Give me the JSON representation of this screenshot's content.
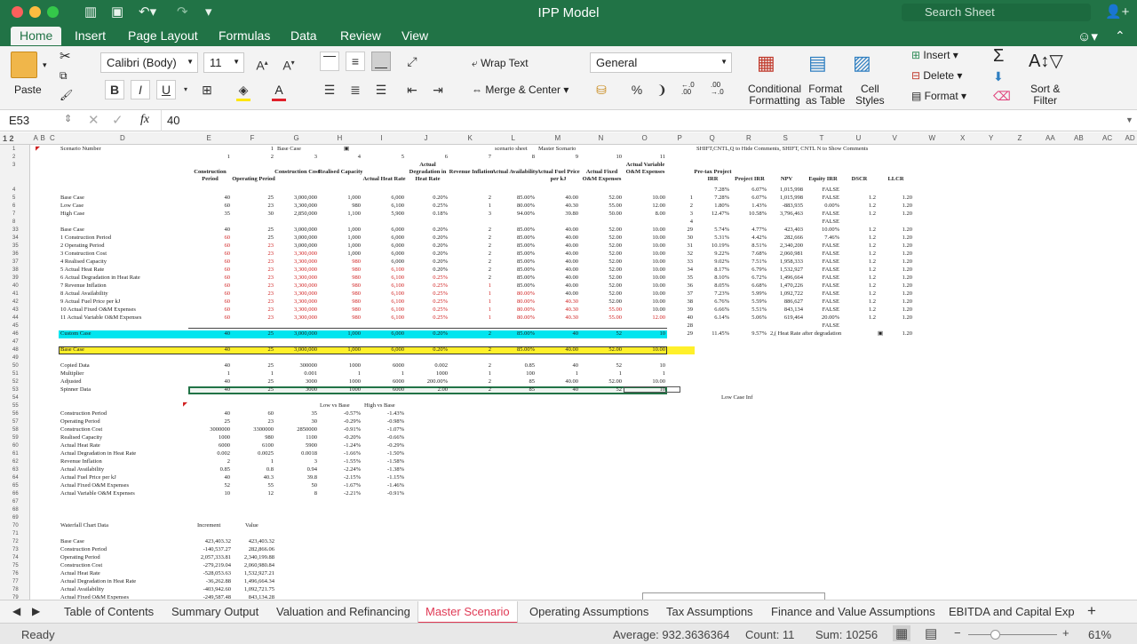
{
  "window": {
    "title": "IPP Model",
    "search_placeholder": "Search Sheet"
  },
  "ribbon_tabs": [
    "Home",
    "Insert",
    "Page Layout",
    "Formulas",
    "Data",
    "Review",
    "View"
  ],
  "ribbon": {
    "paste": "Paste",
    "font_name": "Calibri (Body)",
    "font_size": "11",
    "bold": "B",
    "italic": "I",
    "underline": "U",
    "wrap_text": "Wrap Text",
    "merge_center": "Merge & Center",
    "number_format": "General",
    "percent": "%",
    "comma": "❩",
    "conditional_formatting": [
      "Conditional",
      "Formatting"
    ],
    "format_as_table": [
      "Format",
      "as Table"
    ],
    "cell_styles": [
      "Cell",
      "Styles"
    ],
    "insert": "Insert",
    "delete": "Delete",
    "format": "Format",
    "sort_filter": [
      "Sort &",
      "Filter"
    ]
  },
  "formula_bar": {
    "name_box": "E53",
    "fx": "fx",
    "value": "40"
  },
  "columns": [
    "A",
    "B",
    "C",
    "D",
    "E",
    "F",
    "G",
    "H",
    "I",
    "J",
    "K",
    "L",
    "M",
    "N",
    "O",
    "P",
    "Q",
    "R",
    "S",
    "T",
    "U",
    "V",
    "W",
    "X",
    "Y",
    "Z",
    "AA",
    "AB",
    "AC",
    "AD"
  ],
  "outline_levels": "1 2",
  "top": {
    "scenario_number": "Scenario Number",
    "scenario_index": "1",
    "base_case_label": "Base Case",
    "scenario_sheet": "scenario sheet",
    "master_scenario": "Master Scenario",
    "shortcut_note": "SHIFT,CNTL,Q to Hide Comments, SHIFT, CNTL N to Show Comments",
    "col_numbers": [
      "1",
      "2",
      "3",
      "4",
      "5",
      "6",
      "7",
      "8",
      "9",
      "10",
      "11"
    ]
  },
  "headers": [
    "Construction Period",
    "Operating Period",
    "Construction Cost",
    "Realised Capacity",
    "Actual Heat Rate",
    "Actual Degradation in Heat Rate",
    "Revenue Inflation",
    "Actual Availability",
    "Actual Fuel Price per kJ",
    "Actual Fixed O&M Expenses",
    "Actual Variable O&M Expenses"
  ],
  "result_headers": [
    "Pre-tax Project IRR",
    "Project IRR",
    "NPV",
    "Equity IRR",
    "DSCR",
    "LLCR"
  ],
  "rows_top": [
    {
      "n": "4",
      "label": "",
      "v": [],
      "idx": "",
      "res": [
        "7.28%",
        "6.07%",
        "1,015,998",
        "FALSE",
        "",
        ""
      ]
    },
    {
      "n": "5",
      "label": "Base Case",
      "v": [
        "40",
        "25",
        "3,000,000",
        "1,000",
        "6,000",
        "0.20%",
        "2",
        "85.00%",
        "40.00",
        "52.00",
        "10.00"
      ],
      "idx": "1",
      "res": [
        "7.28%",
        "6.07%",
        "1,015,998",
        "FALSE",
        "1.2",
        "1.20"
      ]
    },
    {
      "n": "6",
      "label": "Low Case",
      "v": [
        "60",
        "23",
        "3,300,000",
        "980",
        "6,100",
        "0.25%",
        "1",
        "80.00%",
        "40.30",
        "55.00",
        "12.00"
      ],
      "idx": "2",
      "res": [
        "1.80%",
        "1.43%",
        "-883,935",
        "0.00%",
        "1.2",
        "1.20"
      ]
    },
    {
      "n": "7",
      "label": "High Case",
      "v": [
        "35",
        "30",
        "2,850,000",
        "1,100",
        "5,900",
        "0.18%",
        "3",
        "94.00%",
        "39.80",
        "50.00",
        "8.00"
      ],
      "idx": "3",
      "res": [
        "12.47%",
        "10.58%",
        "3,796,463",
        "FALSE",
        "1.2",
        "1.20"
      ]
    },
    {
      "n": "8",
      "label": "",
      "v": [],
      "idx": "4",
      "res": [
        "",
        "",
        "",
        "FALSE",
        "",
        ""
      ]
    }
  ],
  "rows_sens": [
    {
      "n": "33",
      "label": "Base Case",
      "red": 0,
      "v": [
        "40",
        "25",
        "3,000,000",
        "1,000",
        "6,000",
        "0.20%",
        "2",
        "85.00%",
        "40.00",
        "52.00",
        "10.00"
      ],
      "idx": "29",
      "res": [
        "5.74%",
        "4.77%",
        "423,403",
        "10.00%",
        "1.2",
        "1.20"
      ]
    },
    {
      "n": "34",
      "label": "1 Construction Period",
      "red": 1,
      "v": [
        "60",
        "25",
        "3,000,000",
        "1,000",
        "6,000",
        "0.20%",
        "2",
        "85.00%",
        "40.00",
        "52.00",
        "10.00"
      ],
      "idx": "30",
      "res": [
        "5.31%",
        "4.42%",
        "282,666",
        "7.46%",
        "1.2",
        "1.20"
      ]
    },
    {
      "n": "35",
      "label": "2 Operating Period",
      "red": 2,
      "v": [
        "60",
        "23",
        "3,000,000",
        "1,000",
        "6,000",
        "0.20%",
        "2",
        "85.00%",
        "40.00",
        "52.00",
        "10.00"
      ],
      "idx": "31",
      "res": [
        "10.19%",
        "8.51%",
        "2,340,200",
        "FALSE",
        "1.2",
        "1.20"
      ]
    },
    {
      "n": "36",
      "label": "3 Construction Cost",
      "red": 3,
      "v": [
        "60",
        "23",
        "3,300,000",
        "1,000",
        "6,000",
        "0.20%",
        "2",
        "85.00%",
        "40.00",
        "52.00",
        "10.00"
      ],
      "idx": "32",
      "res": [
        "9.22%",
        "7.68%",
        "2,060,981",
        "FALSE",
        "1.2",
        "1.20"
      ]
    },
    {
      "n": "37",
      "label": "4 Realised Capacity",
      "red": 4,
      "v": [
        "60",
        "23",
        "3,300,000",
        "980",
        "6,000",
        "0.20%",
        "2",
        "85.00%",
        "40.00",
        "52.00",
        "10.00"
      ],
      "idx": "33",
      "res": [
        "9.02%",
        "7.51%",
        "1,958,333",
        "FALSE",
        "1.2",
        "1.20"
      ]
    },
    {
      "n": "38",
      "label": "5 Actual Heat Rate",
      "red": 5,
      "v": [
        "60",
        "23",
        "3,300,000",
        "980",
        "6,100",
        "0.20%",
        "2",
        "85.00%",
        "40.00",
        "52.00",
        "10.00"
      ],
      "idx": "34",
      "res": [
        "8.17%",
        "6.79%",
        "1,532,927",
        "FALSE",
        "1.2",
        "1.20"
      ]
    },
    {
      "n": "39",
      "label": "6 Actual Degradation in Heat Rate",
      "red": 6,
      "v": [
        "60",
        "23",
        "3,300,000",
        "980",
        "6,100",
        "0.25%",
        "2",
        "85.00%",
        "40.00",
        "52.00",
        "10.00"
      ],
      "idx": "35",
      "res": [
        "8.10%",
        "6.72%",
        "1,496,664",
        "FALSE",
        "1.2",
        "1.20"
      ]
    },
    {
      "n": "40",
      "label": "7 Revenue Inflation",
      "red": 7,
      "v": [
        "60",
        "23",
        "3,300,000",
        "980",
        "6,100",
        "0.25%",
        "1",
        "85.00%",
        "40.00",
        "52.00",
        "10.00"
      ],
      "idx": "36",
      "res": [
        "8.05%",
        "6.68%",
        "1,470,226",
        "FALSE",
        "1.2",
        "1.20"
      ]
    },
    {
      "n": "41",
      "label": "8 Actual Availability",
      "red": 8,
      "v": [
        "60",
        "23",
        "3,300,000",
        "980",
        "6,100",
        "0.25%",
        "1",
        "80.00%",
        "40.00",
        "52.00",
        "10.00"
      ],
      "idx": "37",
      "res": [
        "7.23%",
        "5.99%",
        "1,092,722",
        "FALSE",
        "1.2",
        "1.20"
      ]
    },
    {
      "n": "42",
      "label": "9 Actual Fuel Price per kJ",
      "red": 9,
      "v": [
        "60",
        "23",
        "3,300,000",
        "980",
        "6,100",
        "0.25%",
        "1",
        "80.00%",
        "40.30",
        "52.00",
        "10.00"
      ],
      "idx": "38",
      "res": [
        "6.76%",
        "5.59%",
        "886,627",
        "FALSE",
        "1.2",
        "1.20"
      ]
    },
    {
      "n": "43",
      "label": "10 Actual Fixed O&M Expenses",
      "red": 10,
      "v": [
        "60",
        "23",
        "3,300,000",
        "980",
        "6,100",
        "0.25%",
        "1",
        "80.00%",
        "40.30",
        "55.00",
        "10.00"
      ],
      "idx": "39",
      "res": [
        "6.66%",
        "5.51%",
        "843,134",
        "FALSE",
        "1.2",
        "1.20"
      ]
    },
    {
      "n": "44",
      "label": "11 Actual Variable O&M Expenses",
      "red": 11,
      "v": [
        "60",
        "23",
        "3,300,000",
        "980",
        "6,100",
        "0.25%",
        "1",
        "80.00%",
        "40.30",
        "55.00",
        "12.00"
      ],
      "idx": "40",
      "res": [
        "6.14%",
        "5.06%",
        "619,464",
        "20.00%",
        "1.2",
        "1.20"
      ]
    }
  ],
  "row45": {
    "idx": "28",
    "res": "FALSE"
  },
  "custom_case": {
    "label": "Custom Case",
    "v": [
      "40",
      "25",
      "3,000,000",
      "1,000",
      "6,000",
      "0.20%",
      "2",
      "85.00%",
      "40",
      "52",
      "10"
    ],
    "idx": "29",
    "res": [
      "11.45%",
      "9.57%",
      "2,( Heat Rate after degradation"
    ],
    "llcr": "1.20"
  },
  "base_case2": {
    "label": "Base Case",
    "v": [
      "40",
      "25",
      "3,000,000",
      "1,000",
      "6,000",
      "0.20%",
      "2",
      "85.00%",
      "40.00",
      "52.00",
      "10.00"
    ]
  },
  "copied": [
    {
      "n": "50",
      "label": "Copied Data",
      "v": [
        "40",
        "25",
        "300000",
        "1000",
        "6000",
        "0.002",
        "2",
        "0.85",
        "40",
        "52",
        "10"
      ]
    },
    {
      "n": "51",
      "label": "Multiplier",
      "v": [
        "1",
        "1",
        "0.001",
        "1",
        "1",
        "1000",
        "1",
        "100",
        "1",
        "1",
        "1"
      ]
    },
    {
      "n": "52",
      "label": "Adjusted",
      "v": [
        "40",
        "25",
        "3000",
        "1000",
        "6000",
        "200.00%",
        "2",
        "85",
        "40.00",
        "52.00",
        "10.00"
      ]
    },
    {
      "n": "53",
      "label": "Spinner Data",
      "v": [
        "40",
        "25",
        "3000",
        "1000",
        "6000",
        "2.00",
        "2",
        "85",
        "40",
        "52",
        "10"
      ]
    }
  ],
  "low_case_info": "Low Case Inf",
  "sens_table": {
    "h1": "Low vs Base",
    "h2": "High vs Base",
    "rows": [
      {
        "n": "56",
        "label": "Construction Period",
        "v": [
          "40",
          "60",
          "35",
          "-0.57%",
          "-1.43%"
        ]
      },
      {
        "n": "57",
        "label": "Operating Period",
        "v": [
          "25",
          "23",
          "30",
          "-0.29%",
          "-0.98%"
        ]
      },
      {
        "n": "58",
        "label": "Construction Cost",
        "v": [
          "3000000",
          "3300000",
          "2850000",
          "-0.91%",
          "-1.07%"
        ]
      },
      {
        "n": "59",
        "label": "Realised Capacity",
        "v": [
          "1000",
          "980",
          "1100",
          "-0.20%",
          "-0.66%"
        ]
      },
      {
        "n": "60",
        "label": "Actual Heat Rate",
        "v": [
          "6000",
          "6100",
          "5900",
          "-1.24%",
          "-0.29%"
        ]
      },
      {
        "n": "61",
        "label": "Actual Degradation in Heat Rate",
        "v": [
          "0.002",
          "0.0025",
          "0.0018",
          "-1.66%",
          "-1.50%"
        ]
      },
      {
        "n": "62",
        "label": "Revenue Inflation",
        "v": [
          "2",
          "1",
          "3",
          "-1.55%",
          "-1.58%"
        ]
      },
      {
        "n": "63",
        "label": "Actual Availability",
        "v": [
          "0.85",
          "0.8",
          "0.94",
          "-2.24%",
          "-1.38%"
        ]
      },
      {
        "n": "64",
        "label": "Actual Fuel Price per kJ",
        "v": [
          "40",
          "40.3",
          "39.8",
          "-2.15%",
          "-1.15%"
        ]
      },
      {
        "n": "65",
        "label": "Actual Fixed O&M Expenses",
        "v": [
          "52",
          "55",
          "50",
          "-1.67%",
          "-1.46%"
        ]
      },
      {
        "n": "66",
        "label": "Actual Variable O&M Expenses",
        "v": [
          "10",
          "12",
          "8",
          "-2.21%",
          "-0.91%"
        ]
      }
    ]
  },
  "waterfall": {
    "title": "Waterfall Chart Data",
    "h1": "Increment",
    "h2": "Value",
    "rows": [
      {
        "n": "72",
        "label": "Base Case",
        "v": [
          "423,403.32",
          "423,403.32"
        ]
      },
      {
        "n": "73",
        "label": "Construction Period",
        "v": [
          "-140,537.27",
          "282,866.06"
        ]
      },
      {
        "n": "74",
        "label": "Operating Period",
        "v": [
          "2,057,333.81",
          "2,340,199.88"
        ]
      },
      {
        "n": "75",
        "label": "Construction Cost",
        "v": [
          "-279,219.04",
          "2,060,980.84"
        ]
      },
      {
        "n": "76",
        "label": "Actual Heat Rate",
        "v": [
          "-528,053.63",
          "1,532,927.21"
        ]
      },
      {
        "n": "77",
        "label": "Actual Degradation in Heat Rate",
        "v": [
          "-36,262.88",
          "1,496,664.34"
        ]
      },
      {
        "n": "78",
        "label": "Actual Availability",
        "v": [
          "-403,942.60",
          "1,092,721.75"
        ]
      },
      {
        "n": "79",
        "label": "Actual Fixed O&M Expenses",
        "v": [
          "-249,587.48",
          "843,134.28"
        ]
      }
    ]
  },
  "row_numbers": [
    "1",
    "2",
    "3",
    "4",
    "5",
    "6",
    "7",
    "8",
    "33",
    "34",
    "35",
    "36",
    "37",
    "38",
    "39",
    "40",
    "41",
    "42",
    "43",
    "44",
    "45",
    "46",
    "47",
    "48",
    "49",
    "50",
    "51",
    "52",
    "53",
    "54",
    "55",
    "56",
    "57",
    "58",
    "59",
    "60",
    "61",
    "62",
    "63",
    "64",
    "65",
    "66",
    "67",
    "68",
    "69",
    "70",
    "71",
    "72",
    "73",
    "74",
    "75",
    "76",
    "77",
    "78",
    "79"
  ],
  "sheet_tabs": [
    "Table of Contents",
    "Summary Output",
    "Valuation and Refinancing",
    "Master Scenario",
    "Operating Assumptions",
    "Tax Assumptions",
    "Finance and Value Assumptions",
    "EBITDA and Capital Exp"
  ],
  "active_sheet": "Master Scenario",
  "status": {
    "ready": "Ready",
    "average": "Average: 932.3636364",
    "count": "Count: 11",
    "sum": "Sum: 10256",
    "zoom": "61%"
  },
  "colors": {
    "excel_green": "#217346",
    "cyan": "#00e5ef",
    "yellow": "#fff02a",
    "active_tab": "#e03a55",
    "red_text": "#d02020"
  }
}
